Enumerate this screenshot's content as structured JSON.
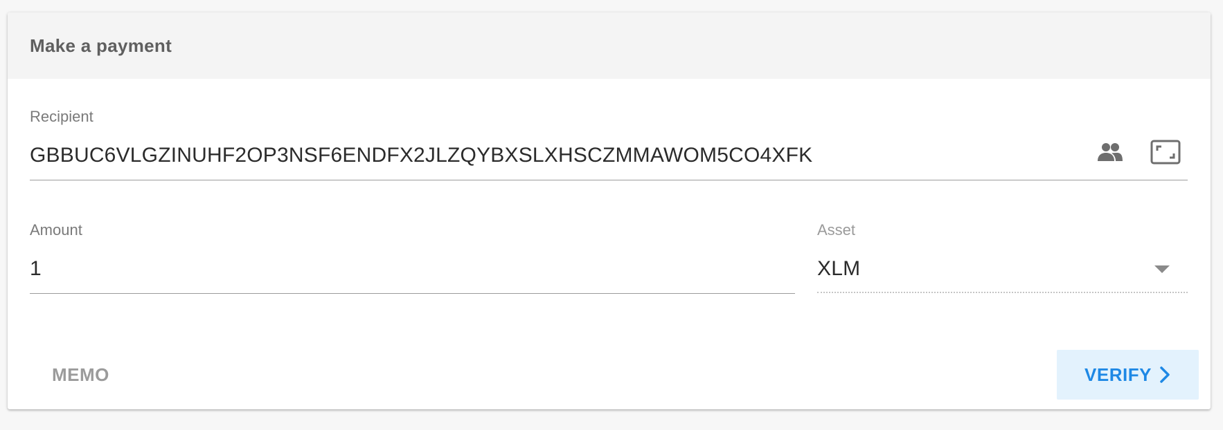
{
  "card": {
    "title": "Make a payment"
  },
  "recipient": {
    "label": "Recipient",
    "value": "GBBUC6VLGZINUHF2OP3NSF6ENDFX2JLZQYBXSLXHSCZMMAWOM5CO4XFK",
    "icons": [
      "contacts-icon",
      "qr-scan-icon"
    ]
  },
  "amount": {
    "label": "Amount",
    "value": "1"
  },
  "asset": {
    "label": "Asset",
    "value": "XLM"
  },
  "buttons": {
    "memo": "MEMO",
    "verify": "VERIFY"
  },
  "colors": {
    "accent": "#1e88e5",
    "accent_bg": "#e3f2fd",
    "header_bg": "#f4f4f4"
  }
}
